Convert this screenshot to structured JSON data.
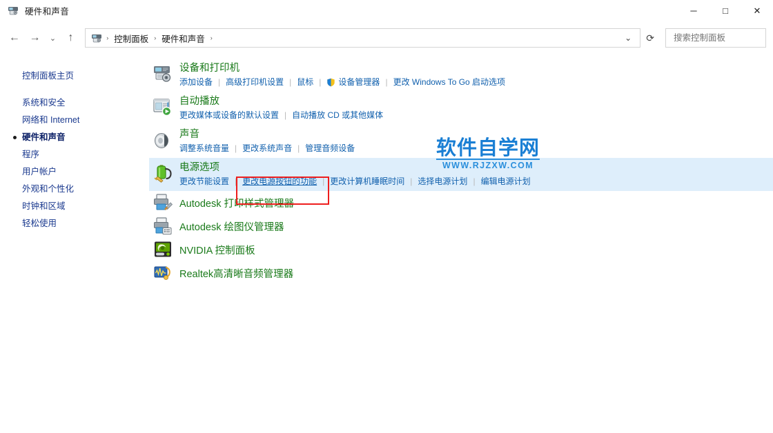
{
  "window": {
    "title": "硬件和声音",
    "icon": "devices-printers-icon",
    "minimize_label": "─",
    "maximize_label": "□",
    "close_label": "✕"
  },
  "nav": {
    "back_label": "←",
    "forward_label": "→",
    "recent_label": "⌄",
    "up_label": "↑",
    "refresh_label": "⟳",
    "dropdown_label": "⌄",
    "breadcrumb": [
      {
        "label": "控制面板"
      },
      {
        "label": "硬件和声音"
      }
    ],
    "separator": "›"
  },
  "search": {
    "placeholder": "搜索控制面板",
    "value": "",
    "icon": "search-icon"
  },
  "sidebar": {
    "home": "控制面板主页",
    "items": [
      {
        "label": "系统和安全",
        "current": false
      },
      {
        "label": "网络和 Internet",
        "current": false
      },
      {
        "label": "硬件和声音",
        "current": true
      },
      {
        "label": "程序",
        "current": false
      },
      {
        "label": "用户帐户",
        "current": false
      },
      {
        "label": "外观和个性化",
        "current": false
      },
      {
        "label": "时钟和区域",
        "current": false
      },
      {
        "label": "轻松使用",
        "current": false
      }
    ]
  },
  "categories": [
    {
      "title": "设备和打印机",
      "icon": "printer-camera-icon",
      "highlight": false,
      "links": [
        {
          "label": "添加设备",
          "shield": false,
          "underlined": false
        },
        {
          "label": "高级打印机设置",
          "shield": false,
          "underlined": false
        },
        {
          "label": "鼠标",
          "shield": false,
          "underlined": false
        },
        {
          "label": "设备管理器",
          "shield": true,
          "underlined": false
        },
        {
          "label": "更改 Windows To Go 启动选项",
          "shield": false,
          "underlined": false
        }
      ]
    },
    {
      "title": "自动播放",
      "icon": "autoplay-icon",
      "highlight": false,
      "links": [
        {
          "label": "更改媒体或设备的默认设置",
          "shield": false,
          "underlined": false
        },
        {
          "label": "自动播放 CD 或其他媒体",
          "shield": false,
          "underlined": false
        }
      ]
    },
    {
      "title": "声音",
      "icon": "speaker-icon",
      "highlight": false,
      "links": [
        {
          "label": "调整系统音量",
          "shield": false,
          "underlined": false
        },
        {
          "label": "更改系统声音",
          "shield": false,
          "underlined": false
        },
        {
          "label": "管理音频设备",
          "shield": false,
          "underlined": false
        }
      ]
    },
    {
      "title": "电源选项",
      "icon": "battery-power-icon",
      "highlight": true,
      "links": [
        {
          "label": "更改节能设置",
          "shield": false,
          "underlined": false
        },
        {
          "label": "更改电源按钮的功能",
          "shield": false,
          "underlined": true
        },
        {
          "label": "更改计算机睡眠时间",
          "shield": false,
          "underlined": false
        },
        {
          "label": "选择电源计划",
          "shield": false,
          "underlined": false
        },
        {
          "label": "编辑电源计划",
          "shield": false,
          "underlined": false
        }
      ]
    }
  ],
  "apps": [
    {
      "title": "Autodesk 打印样式管理器",
      "icon": "printer-brush-icon"
    },
    {
      "title": "Autodesk 绘图仪管理器",
      "icon": "printer-list-icon"
    },
    {
      "title": "NVIDIA 控制面板",
      "icon": "nvidia-icon"
    },
    {
      "title": "Realtek高清晰音频管理器",
      "icon": "realtek-audio-icon"
    }
  ],
  "annotation": {
    "target": "更改电源按钮的功能",
    "color": "#ee1d1d"
  },
  "watermark": {
    "name": "软件自学网",
    "url": "WWW.RJZXW.COM",
    "color": "#1a7fd4"
  },
  "colors": {
    "heading_green": "#1a7a1a",
    "link_blue": "#1160ad",
    "sidebar_blue": "#1b3a8f",
    "highlight_row": "#deeefb",
    "annotation_red": "#ee1d1d"
  }
}
